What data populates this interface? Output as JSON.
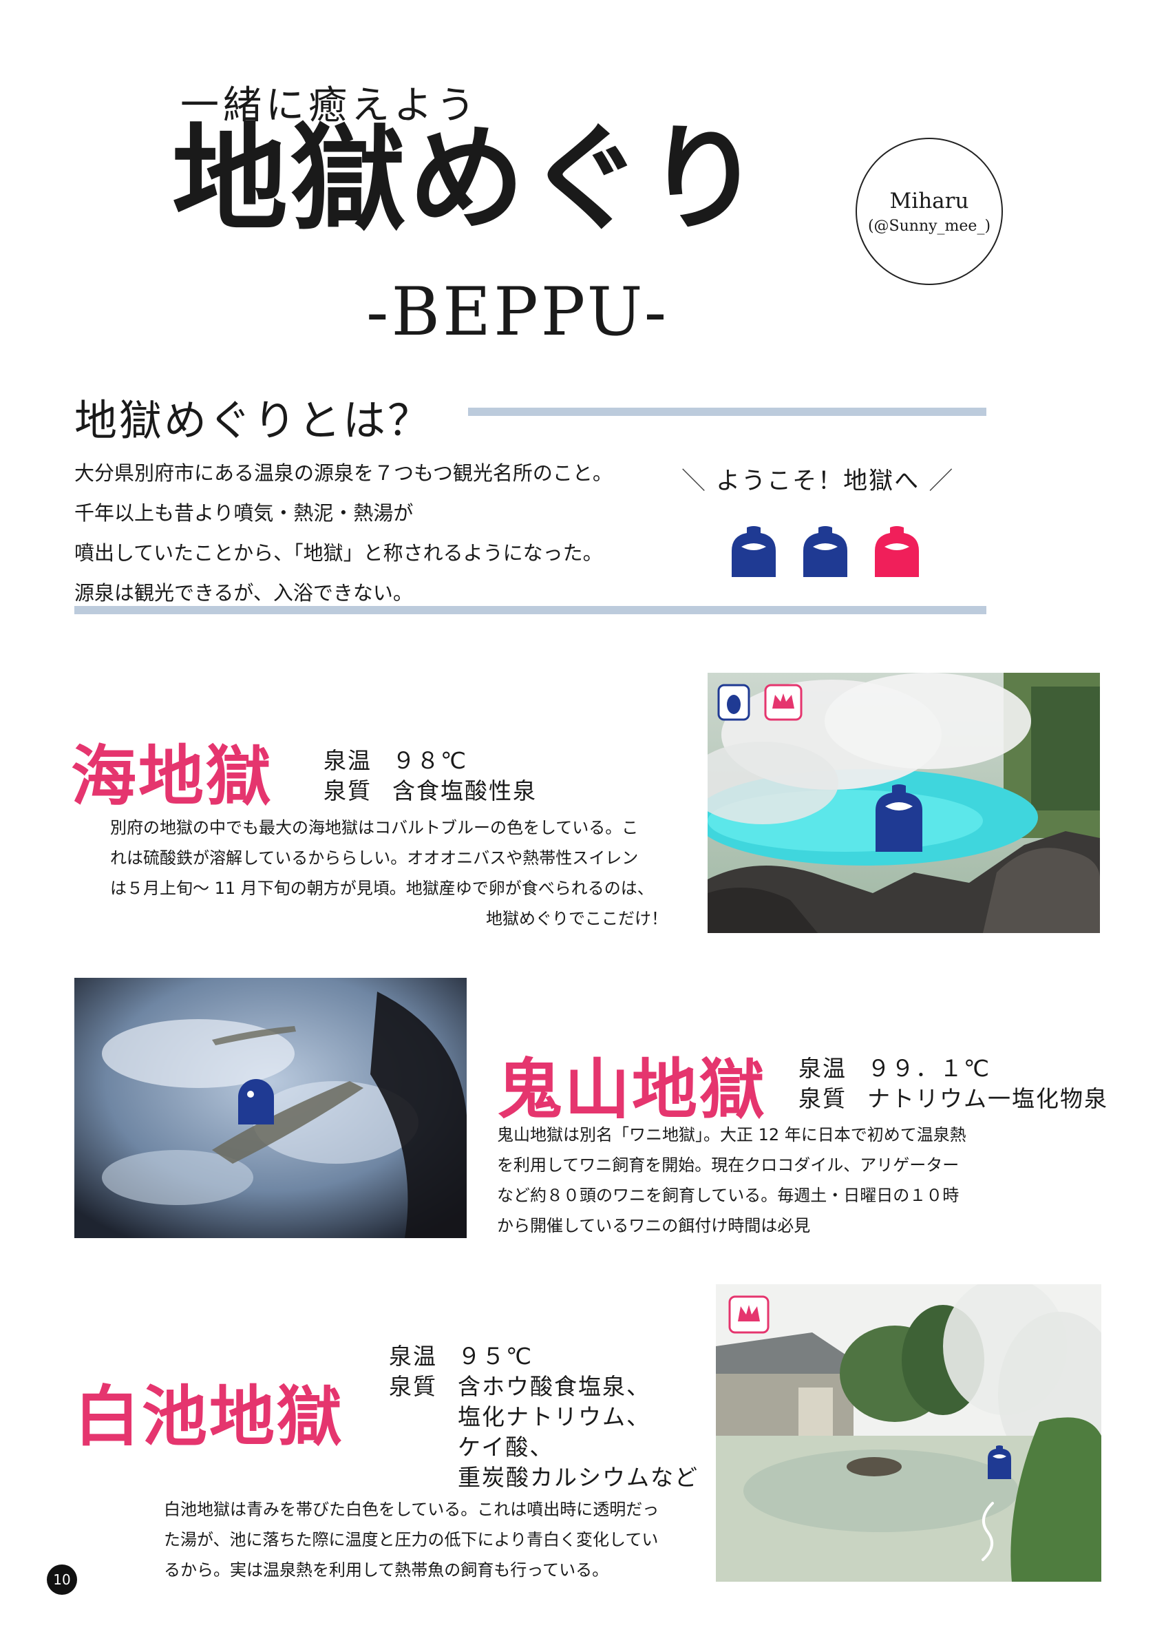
{
  "header": {
    "subtitle": "一緒に癒えよう",
    "title": "地獄めぐり",
    "location": "-BEPPU-",
    "author_name": "Miharu",
    "author_handle": "(@Sunny_mee_)"
  },
  "intro": {
    "heading": "地獄めぐりとは？",
    "lines": [
      "大分県別府市にある温泉の源泉を７つもつ観光名所のこと。",
      "千年以上も昔より噴気・熱泥・熱湯が",
      "噴出していたことから、「地獄」と称されるようになった。",
      "源泉は観光できるが、入浴できない。"
    ],
    "welcome_slash_left": "＼",
    "welcome": "ようこそ！地獄へ",
    "welcome_slash_right": "／"
  },
  "sections": [
    {
      "title": "海地獄",
      "temp_label": "泉温",
      "temp": "９８℃",
      "quality_label": "泉質",
      "quality_lines": [
        "含食塩酸性泉"
      ],
      "lines": [
        "別府の地獄の中でも最大の海地獄はコバルトブルーの色をしている。こ",
        "れは硫酸鉄が溶解しているかららしい。オオオニバスや熱帯性スイレン",
        "は５月上旬～ 11 月下旬の朝方が見頃。地獄産ゆで卵が食べられるのは、",
        "地獄めぐりでここだけ！"
      ]
    },
    {
      "title": "鬼山地獄",
      "temp_label": "泉温",
      "temp": "９９．１℃",
      "quality_label": "泉質",
      "quality_lines": [
        "ナトリウム一塩化物泉"
      ],
      "lines": [
        "鬼山地獄は別名「ワニ地獄」。大正 12 年に日本で初めて温泉熱",
        "を利用してワニ飼育を開始。現在クロコダイル、アリゲーター",
        "など約８０頭のワニを飼育している。毎週土・日曜日の１０時",
        "から開催しているワニの餌付け時間は必見"
      ]
    },
    {
      "title": "白池地獄",
      "temp_label": "泉温",
      "temp": "９５℃",
      "quality_label": "泉質",
      "quality_lines": [
        "含ホウ酸食塩泉、",
        "塩化ナトリウム、",
        "ケイ酸、",
        "重炭酸カルシウムなど"
      ],
      "lines": [
        "白池地獄は青みを帯びた白色をしている。これは噴出時に透明だっ",
        "た湯が、池に落ちた際に温度と圧力の低下により青白く変化してい",
        "るから。実は温泉熱を利用して熱帯魚の飼育も行っている。"
      ]
    }
  ],
  "page_number": "10",
  "colors": {
    "accent_pink": "#e5356e",
    "mascot_blue": "#1f3a93",
    "rule": "#bccbdc"
  }
}
